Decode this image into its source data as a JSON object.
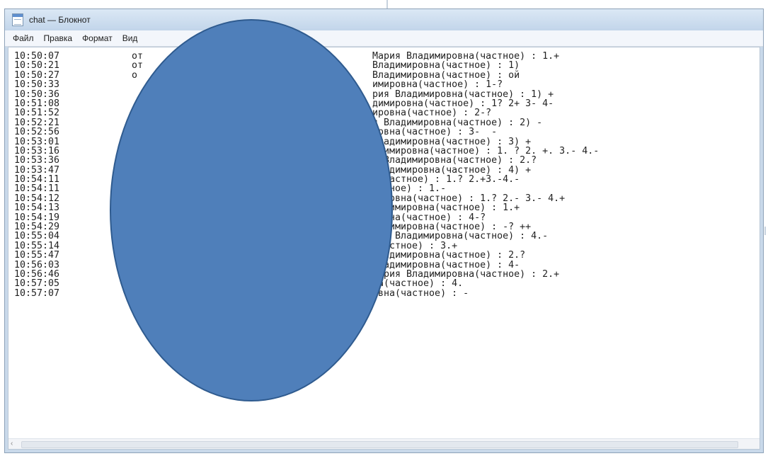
{
  "window": {
    "title": "chat — Блокнот"
  },
  "menu": {
    "items": [
      "Файл",
      "Правка",
      "Формат",
      "Вид"
    ]
  },
  "editor": {
    "lines": [
      {
        "time": "10:50:07",
        "prefix": "от",
        "text": "Мария Владимировна(частное) : 1.+"
      },
      {
        "time": "10:50:21",
        "prefix": "от",
        "text": "Владимировна(частное) : 1)"
      },
      {
        "time": "10:50:27",
        "prefix": "о",
        "text": "Владимировна(частное) : ой"
      },
      {
        "time": "10:50:33",
        "prefix": "",
        "text": "имировна(частное) : 1-?"
      },
      {
        "time": "10:50:36",
        "prefix": "",
        "text": "рия Владимировна(частное) : 1) +"
      },
      {
        "time": "10:51:08",
        "prefix": "",
        "text": "димировна(частное) : 1? 2+ 3- 4-"
      },
      {
        "time": "10:51:52",
        "prefix": "",
        "text": "ировна(частное) : 2-?"
      },
      {
        "time": "10:52:21",
        "prefix": "",
        "text": "я Владимировна(частное) : 2) -"
      },
      {
        "time": "10:52:56",
        "prefix": "",
        "text": "ровна(частное) : 3-  -"
      },
      {
        "time": "10:53:01",
        "prefix": "",
        "text": "Владимировна(частное) : 3) +"
      },
      {
        "time": "10:53:16",
        "prefix": "",
        "text": "адимировна(частное) : 1. ? 2. +. 3.- 4.-"
      },
      {
        "time": "10:53:36",
        "prefix": "",
        "text": "я Владимировна(частное) : 2.?"
      },
      {
        "time": "10:53:47",
        "prefix": "",
        "text": "Владимировна(частное) : 4) +"
      },
      {
        "time": "10:54:11",
        "prefix": "",
        "text": "а(частное) : 1.? 2.+3.-4.-"
      },
      {
        "time": "10:54:11",
        "prefix": "",
        "text": "астное) : 1.-"
      },
      {
        "time": "10:54:12",
        "prefix": "",
        "text": "мировна(частное) : 1.? 2.- 3.- 4.+"
      },
      {
        "time": "10:54:13",
        "prefix": "",
        "text": "ладимировна(частное) : 1.+"
      },
      {
        "time": "10:54:19",
        "prefix": "",
        "text": "ровна(частное) : 4-?"
      },
      {
        "time": "10:54:29",
        "prefix": "",
        "text": "ладимировна(частное) : -? ++"
      },
      {
        "time": "10:55:04",
        "prefix": "",
        "text": "рия Владимировна(частное) : 4.-"
      },
      {
        "time": "10:55:14",
        "prefix": "",
        "text": "(частное) : 3.+"
      },
      {
        "time": "10:55:47",
        "prefix": "",
        "text": "Владимировна(частное) : 2.?"
      },
      {
        "time": "10:56:03",
        "prefix": "",
        "text": "Владимировна(частное) : 4-"
      },
      {
        "time": "10:56:46",
        "prefix": "о",
        "text": "Мария Владимировна(частное) : 2.+"
      },
      {
        "time": "10:57:05",
        "prefix": "о",
        "text": "на(частное) : 4."
      },
      {
        "time": "10:57:07",
        "prefix": "от",
        "text": "овна(частное) : -"
      }
    ]
  }
}
